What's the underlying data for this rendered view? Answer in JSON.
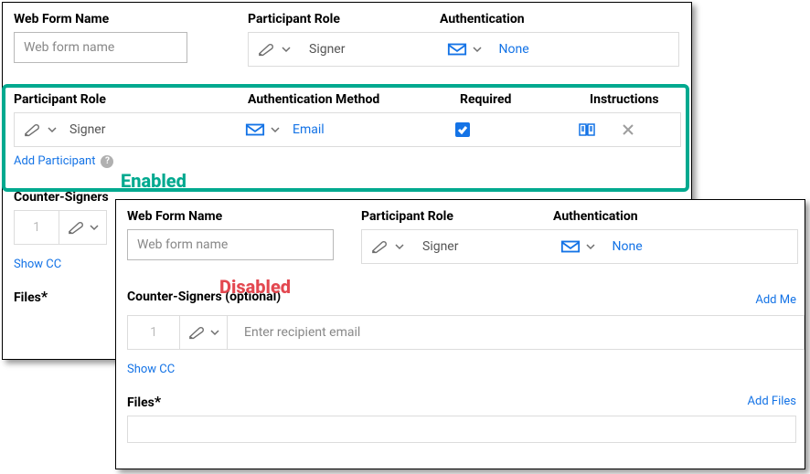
{
  "back": {
    "webFormNameLabel": "Web Form Name",
    "webFormNamePlaceholder": "Web form name",
    "participantRoleLabel": "Participant Role",
    "authenticationLabel": "Authentication",
    "roleValue": "Signer",
    "authValue": "None",
    "participants": {
      "headers": {
        "role": "Participant Role",
        "method": "Authentication Method",
        "required": "Required",
        "instructions": "Instructions"
      },
      "row": {
        "role": "Signer",
        "method": "Email"
      },
      "addParticipant": "Add Participant"
    },
    "counterSignersLabel": "Counter-Signers",
    "orderValue": "1",
    "showCC": "Show CC",
    "filesLabel": "Files",
    "filesAsterisk": "*"
  },
  "front": {
    "webFormNameLabel": "Web Form Name",
    "webFormNamePlaceholder": "Web form name",
    "participantRoleLabel": "Participant Role",
    "authenticationLabel": "Authentication",
    "roleValue": "Signer",
    "authValue": "None",
    "counterSignersLabel": "Counter-Signers (optional)",
    "addMe": "Add Me",
    "orderValue": "1",
    "recipientPlaceholder": "Enter recipient email",
    "showCC": "Show CC",
    "filesLabel": "Files",
    "filesAsterisk": "*",
    "addFiles": "Add Files"
  },
  "tags": {
    "enabled": "Enabled",
    "disabled": "Disabled"
  }
}
